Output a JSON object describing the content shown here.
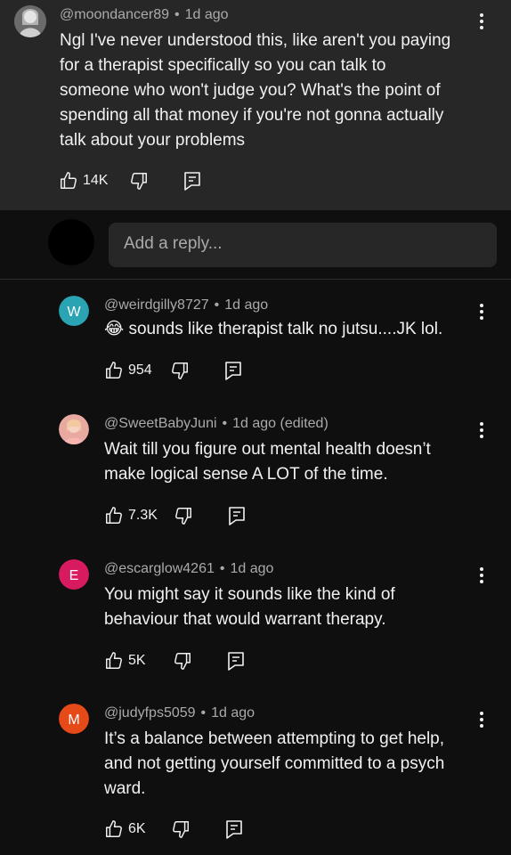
{
  "parent_comment": {
    "handle": "@moondancer89",
    "time": "1d ago",
    "lines": [
      "Ngl I've never understood this, like aren't you paying",
      "for a therapist specifically so you can talk to",
      "someone who won't judge you? What's the point of",
      "spending all that money if you're not gonna actually",
      "talk about your problems"
    ],
    "likes": "14K"
  },
  "reply_box": {
    "placeholder": "Add a reply..."
  },
  "replies": [
    {
      "avatar_letter": "W",
      "avatar_color": "#2aa3b3",
      "handle": "@weirdgilly8727",
      "time": "1d ago",
      "emoji": "😂",
      "lines": [
        "sounds like therapist talk no jutsu....JK lol."
      ],
      "likes": "954"
    },
    {
      "avatar_letter": "",
      "avatar_color": "#e8a9a0",
      "handle": "@SweetBabyJuni",
      "time": "1d ago (edited)",
      "lines": [
        "Wait till you figure out mental health doesn’t",
        "make logical sense A LOT of the time."
      ],
      "likes": "7.3K"
    },
    {
      "avatar_letter": "E",
      "avatar_color": "#d81b60",
      "handle": "@escarglow4261",
      "time": "1d ago",
      "lines": [
        "You might say it sounds like the kind of",
        "behaviour that would warrant therapy."
      ],
      "likes": "5K"
    },
    {
      "avatar_letter": "M",
      "avatar_color": "#e64a19",
      "handle": "@judyfps5059",
      "time": "1d ago",
      "lines": [
        "It’s a balance between attempting to get help,",
        "and not getting yourself committed to a psych",
        "ward."
      ],
      "likes": "6K"
    }
  ],
  "icons": {
    "like": "thumbs-up-icon",
    "dislike": "thumbs-down-icon",
    "reply": "comment-reply-icon",
    "more": "more-vert-icon"
  }
}
